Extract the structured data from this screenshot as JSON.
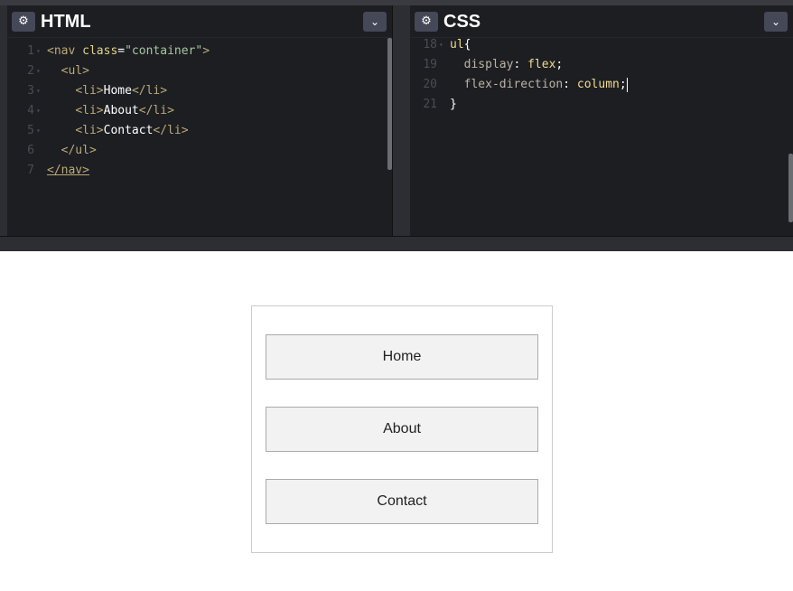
{
  "html_pane": {
    "title": "HTML",
    "gear_icon": "⚙",
    "collapse_icon": "⌄",
    "lines": [
      {
        "num": "1",
        "fold": "▾",
        "parts": [
          {
            "c": "tag",
            "t": "<nav "
          },
          {
            "c": "attr",
            "t": "class"
          },
          {
            "c": "plain",
            "t": "="
          },
          {
            "c": "str",
            "t": "\"container\""
          },
          {
            "c": "tag",
            "t": ">"
          }
        ]
      },
      {
        "num": "2",
        "fold": "▾",
        "parts": [
          {
            "c": "plain",
            "t": "  "
          },
          {
            "c": "tag",
            "t": "<ul>"
          }
        ]
      },
      {
        "num": "3",
        "fold": "▾",
        "parts": [
          {
            "c": "plain",
            "t": "    "
          },
          {
            "c": "tag",
            "t": "<li>"
          },
          {
            "c": "plain",
            "t": "Home"
          },
          {
            "c": "tag",
            "t": "</li>"
          }
        ]
      },
      {
        "num": "4",
        "fold": "▾",
        "parts": [
          {
            "c": "plain",
            "t": "    "
          },
          {
            "c": "tag",
            "t": "<li>"
          },
          {
            "c": "plain",
            "t": "About"
          },
          {
            "c": "tag",
            "t": "</li>"
          }
        ]
      },
      {
        "num": "5",
        "fold": "▾",
        "parts": [
          {
            "c": "plain",
            "t": "    "
          },
          {
            "c": "tag",
            "t": "<li>"
          },
          {
            "c": "plain",
            "t": "Contact"
          },
          {
            "c": "tag",
            "t": "</li>"
          }
        ]
      },
      {
        "num": "6",
        "fold": "",
        "parts": [
          {
            "c": "plain",
            "t": "  "
          },
          {
            "c": "tag",
            "t": "</ul>"
          }
        ]
      },
      {
        "num": "7",
        "fold": "",
        "parts": [
          {
            "c": "tag",
            "t": "</nav>"
          }
        ]
      }
    ]
  },
  "css_pane": {
    "title": "CSS",
    "gear_icon": "⚙",
    "collapse_icon": "⌄",
    "lines": [
      {
        "num": "18",
        "fold": "▾",
        "parts": [
          {
            "c": "val",
            "t": "ul"
          },
          {
            "c": "punc",
            "t": "{"
          }
        ]
      },
      {
        "num": "19",
        "fold": "",
        "parts": [
          {
            "c": "plain",
            "t": "  "
          },
          {
            "c": "prop",
            "t": "display"
          },
          {
            "c": "punc",
            "t": ": "
          },
          {
            "c": "val",
            "t": "flex"
          },
          {
            "c": "punc",
            "t": ";"
          }
        ]
      },
      {
        "num": "20",
        "fold": "",
        "parts": [
          {
            "c": "plain",
            "t": "  "
          },
          {
            "c": "prop",
            "t": "flex-direction"
          },
          {
            "c": "punc",
            "t": ": "
          },
          {
            "c": "val",
            "t": "column"
          },
          {
            "c": "punc",
            "t": ";"
          }
        ],
        "cursor": true
      },
      {
        "num": "21",
        "fold": "",
        "parts": [
          {
            "c": "punc",
            "t": "}"
          }
        ]
      }
    ]
  },
  "preview": {
    "nav_items": [
      "Home",
      "About",
      "Contact"
    ]
  },
  "colors": {
    "editor_bg": "#1d1e22",
    "chrome": "#2d2e33",
    "button_bg": "#444857",
    "nav_item_bg": "#f2f2f2"
  }
}
